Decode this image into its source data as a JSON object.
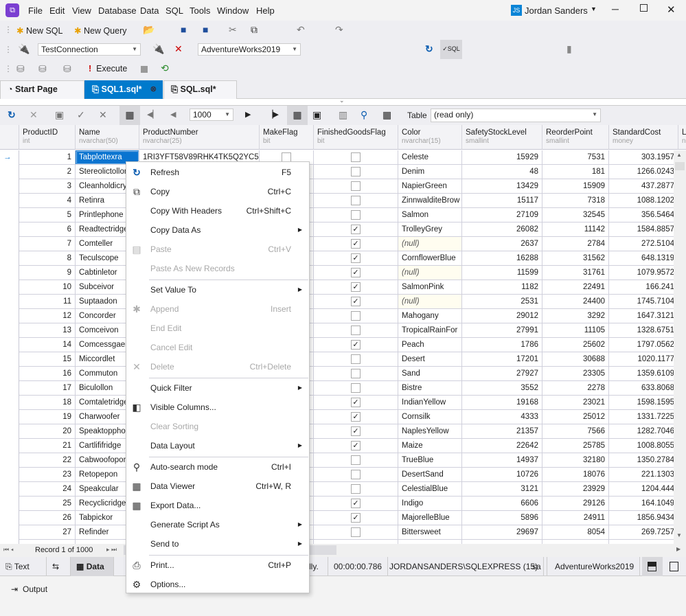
{
  "app": {
    "user_initials": "JS",
    "user_name": "Jordan Sanders"
  },
  "menubar": [
    "File",
    "Edit",
    "View",
    "Database",
    "Data",
    "SQL",
    "Tools",
    "Window",
    "Help"
  ],
  "toolbar": {
    "new_sql": "New SQL",
    "new_query": "New Query",
    "connection": "TestConnection",
    "database": "AdventureWorks2019",
    "execute": "Execute"
  },
  "tabs": [
    {
      "label": "Start Page",
      "active": false
    },
    {
      "label": "SQL1.sql*",
      "active": true
    },
    {
      "label": "SQL.sql*",
      "active": false
    }
  ],
  "grid_toolbar": {
    "page_size": "1000",
    "table_label": "Table",
    "table_value": "(read only)"
  },
  "columns": [
    {
      "name": "ProductID",
      "type": "int"
    },
    {
      "name": "Name",
      "type": "nvarchar(50)"
    },
    {
      "name": "ProductNumber",
      "type": "nvarchar(25)"
    },
    {
      "name": "MakeFlag",
      "type": "bit"
    },
    {
      "name": "FinishedGoodsFlag",
      "type": "bit"
    },
    {
      "name": "Color",
      "type": "nvarchar(15)"
    },
    {
      "name": "SafetyStockLevel",
      "type": "smallint"
    },
    {
      "name": "ReorderPoint",
      "type": "smallint"
    },
    {
      "name": "StandardCost",
      "type": "money"
    },
    {
      "name": "L",
      "type": "n"
    }
  ],
  "rows": [
    [
      1,
      "Tabplottexra",
      "1RI3YFT58V89RHK4TK5Q2YC5E",
      false,
      false,
      "Celeste",
      15929,
      7531,
      "303.1957"
    ],
    [
      2,
      "Stereolictollor",
      "",
      null,
      false,
      "Denim",
      48,
      181,
      "1266.0243"
    ],
    [
      3,
      "Cleanholdicry",
      "",
      null,
      false,
      "NapierGreen",
      13429,
      15909,
      "437.2877"
    ],
    [
      4,
      "Retinra",
      "",
      null,
      false,
      "ZinnwalditeBrow",
      15117,
      7318,
      "1088.1202"
    ],
    [
      5,
      "Printlephone",
      "",
      null,
      false,
      "Salmon",
      27109,
      32545,
      "356.5464"
    ],
    [
      6,
      "Readtectridge",
      "",
      null,
      true,
      "TrolleyGrey",
      26082,
      11142,
      "1584.8857"
    ],
    [
      7,
      "Comteller",
      "",
      null,
      true,
      "(null)",
      2637,
      2784,
      "272.5104"
    ],
    [
      8,
      "Teculscope",
      "",
      null,
      true,
      "CornflowerBlue",
      16288,
      31562,
      "648.1319"
    ],
    [
      9,
      "Cabtinletor",
      "",
      null,
      true,
      "(null)",
      11599,
      31761,
      "1079.9572"
    ],
    [
      10,
      "Subceivor",
      "",
      null,
      true,
      "SalmonPink",
      1182,
      22491,
      "166.241"
    ],
    [
      11,
      "Suptaadon",
      "",
      null,
      true,
      "(null)",
      2531,
      24400,
      "1745.7104"
    ],
    [
      12,
      "Concorder",
      "",
      null,
      false,
      "Mahogany",
      29012,
      3292,
      "1647.3121"
    ],
    [
      13,
      "Comceivon",
      "",
      null,
      false,
      "TropicalRainFor",
      27991,
      11105,
      "1328.6751"
    ],
    [
      14,
      "Comcessgaer",
      "",
      null,
      true,
      "Peach",
      1786,
      25602,
      "1797.0562"
    ],
    [
      15,
      "Miccordlet",
      "",
      null,
      false,
      "Desert",
      17201,
      30688,
      "1020.1177"
    ],
    [
      16,
      "Commuton",
      "",
      null,
      false,
      "Sand",
      27927,
      23305,
      "1359.6109"
    ],
    [
      17,
      "Biculollon",
      "",
      null,
      false,
      "Bistre",
      3552,
      2278,
      "633.8068"
    ],
    [
      18,
      "Comtaletridge",
      "",
      null,
      true,
      "IndianYellow",
      19168,
      23021,
      "1598.1595"
    ],
    [
      19,
      "Charwoofer",
      "",
      null,
      true,
      "Cornsilk",
      4333,
      25012,
      "1331.7225"
    ],
    [
      20,
      "Speaktopphon",
      "",
      null,
      true,
      "NaplesYellow",
      21357,
      7566,
      "1282.7046"
    ],
    [
      21,
      "Cartlififridge",
      "",
      null,
      true,
      "Maize",
      22642,
      25785,
      "1008.8055"
    ],
    [
      22,
      "Cabwoofopon",
      "",
      null,
      false,
      "TrueBlue",
      14937,
      32180,
      "1350.2784"
    ],
    [
      23,
      "Retopepon",
      "",
      null,
      false,
      "DesertSand",
      10726,
      18076,
      "221.1303"
    ],
    [
      24,
      "Speakcular",
      "",
      null,
      false,
      "CelestialBlue",
      3121,
      23929,
      "1204.444"
    ],
    [
      25,
      "Recyclicridge",
      "",
      null,
      true,
      "Indigo",
      6606,
      29126,
      "164.1049"
    ],
    [
      26,
      "Tabpickor",
      "",
      null,
      true,
      "MajorelleBlue",
      5896,
      24911,
      "1856.9434"
    ],
    [
      27,
      "Refinder",
      "",
      null,
      false,
      "Bittersweet",
      29697,
      8054,
      "269.7257"
    ]
  ],
  "navigator": {
    "record_text": "Record 1 of 1000"
  },
  "statusbar": {
    "text_tab": "Text",
    "data_tab": "Data",
    "message_tail": "lly.",
    "elapsed": "00:00:00.786",
    "server": "JORDANSANDERS\\SQLEXPRESS (15)",
    "user": "sa",
    "database": "AdventureWorks2019"
  },
  "output_label": "Output",
  "context_menu": [
    {
      "label": "Refresh",
      "shortcut": "F5",
      "icon": "refresh-icon",
      "glyph": "↻",
      "disabled": false
    },
    {
      "label": "Copy",
      "shortcut": "Ctrl+C",
      "icon": "copy-icon",
      "glyph": "⧉",
      "disabled": false
    },
    {
      "label": "Copy With Headers",
      "shortcut": "Ctrl+Shift+C",
      "disabled": false
    },
    {
      "label": "Copy Data As",
      "submenu": true,
      "disabled": false
    },
    {
      "label": "Paste",
      "shortcut": "Ctrl+V",
      "icon": "paste-icon",
      "glyph": "▤",
      "disabled": true
    },
    {
      "label": "Paste As New Records",
      "disabled": true,
      "sep_after": true
    },
    {
      "label": "Set Value To",
      "submenu": true,
      "disabled": false
    },
    {
      "label": "Append",
      "shortcut": "Insert",
      "icon": "append-icon",
      "glyph": "✱",
      "disabled": true
    },
    {
      "label": "End Edit",
      "disabled": true
    },
    {
      "label": "Cancel Edit",
      "disabled": true
    },
    {
      "label": "Delete",
      "shortcut": "Ctrl+Delete",
      "icon": "delete-icon",
      "glyph": "✕",
      "disabled": true,
      "sep_after": true
    },
    {
      "label": "Quick Filter",
      "submenu": true,
      "disabled": false
    },
    {
      "label": "Visible Columns...",
      "icon": "columns-icon",
      "glyph": "◧",
      "disabled": false
    },
    {
      "label": "Clear Sorting",
      "disabled": true
    },
    {
      "label": "Data Layout",
      "submenu": true,
      "disabled": false,
      "sep_after": true
    },
    {
      "label": "Auto-search mode",
      "shortcut": "Ctrl+I",
      "icon": "auto-search-icon",
      "glyph": "⚲",
      "disabled": false
    },
    {
      "label": "Data Viewer",
      "shortcut": "Ctrl+W, R",
      "icon": "data-viewer-icon",
      "glyph": "▦",
      "disabled": false
    },
    {
      "label": "Export Data...",
      "icon": "export-data-icon",
      "glyph": "▦",
      "disabled": false
    },
    {
      "label": "Generate Script As",
      "submenu": true,
      "disabled": false
    },
    {
      "label": "Send to",
      "submenu": true,
      "disabled": false,
      "sep_after": true
    },
    {
      "label": "Print...",
      "shortcut": "Ctrl+P",
      "icon": "print-icon",
      "glyph": "⎙",
      "disabled": false
    },
    {
      "label": "Options...",
      "icon": "gear-icon",
      "glyph": "⚙",
      "disabled": false
    }
  ],
  "colors": {
    "accent": "#007acc",
    "selection": "#0a74d0",
    "null_bg": "#fffdf0",
    "logo": "#7b3fd1"
  }
}
